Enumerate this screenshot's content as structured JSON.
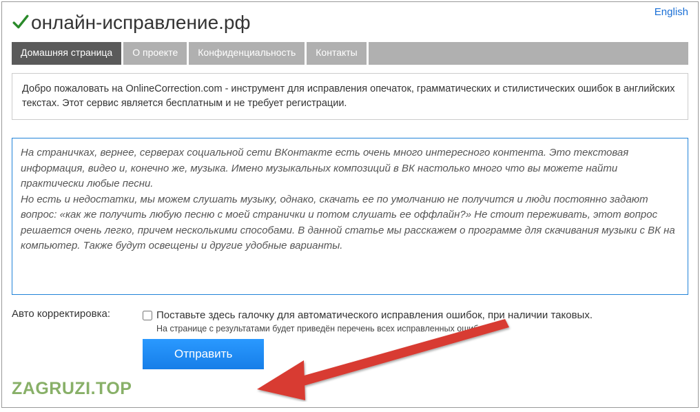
{
  "lang_link": "English",
  "site_title": "онлайн-исправление.рф",
  "nav": [
    {
      "label": "Домашняя страница",
      "active": true
    },
    {
      "label": "О проекте",
      "active": false
    },
    {
      "label": "Конфиденциальность",
      "active": false
    },
    {
      "label": "Контакты",
      "active": false
    }
  ],
  "welcome": "Добро пожаловать на OnlineCorrection.com - инструмент для исправления опечаток, грамматических и стилистических ошибок в английских текстах. Этот сервис является бесплатным и не требует регистрации.",
  "textarea_value": "На страничках, вернее, серверах социальной сети ВКонтакте есть очень много интересного контента. Это текстовая информация, видео и, конечно же, музыка. Имено музыкальных композиций в ВК настолько много что вы можете найти практически любые песни.\nНо есть и недостатки, мы можем слушать музыку, однако, скачать ее по умолчанию не получится и люди постоянно задают вопрос: «как же получить любую песню с моей странички и потом слушать ее оффлайн?» Не стоит переживать, этот вопрос решается очень легко, причем несколькими способами. В данной статье мы расскажем о программе для скачивания музыки с ВК на компьютер. Также будут освещены и другие удобные варианты.",
  "auto_label": "Авто корректировка:",
  "auto_text": "Поставьте здесь галочку для автоматического исправления ошибок, при наличии таковых.",
  "auto_note": "На странице с результатами будет приведён перечень всех исправленных ошибок.",
  "submit_label": "Отправить",
  "watermark": "ZAGRUZI.TOP"
}
